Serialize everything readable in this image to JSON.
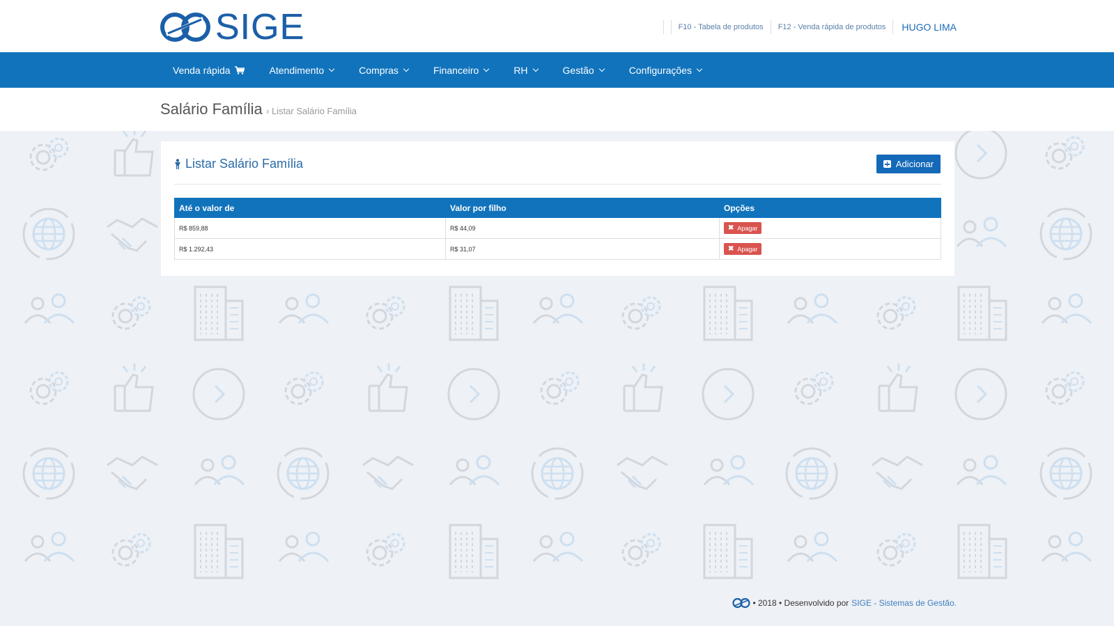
{
  "header": {
    "logo_text": "SIGE",
    "links": [
      "F10 - Tabela de produtos",
      "F12 - Venda rápida de produtos"
    ],
    "user": "HUGO LIMA"
  },
  "nav": {
    "items": [
      {
        "label": "Venda rápida",
        "icon": "cart-icon"
      },
      {
        "label": "Atendimento"
      },
      {
        "label": "Compras"
      },
      {
        "label": "Financeiro"
      },
      {
        "label": "RH"
      },
      {
        "label": "Gestão"
      },
      {
        "label": "Configurações"
      }
    ]
  },
  "page": {
    "title": "Salário Família",
    "breadcrumb": "› Listar Salário Família"
  },
  "panel": {
    "title": "Listar Salário Família",
    "add_label": "Adicionar",
    "columns": [
      "Até o valor de",
      "Valor por filho",
      "Opções"
    ],
    "rows": [
      {
        "ate": "R$ 859,88",
        "valor": "R$ 44,09",
        "action": "Apagar"
      },
      {
        "ate": "R$ 1.292,43",
        "valor": "R$ 31,07",
        "action": "Apagar"
      }
    ]
  },
  "footer": {
    "text": "• 2018 • Desenvolvido por",
    "brand": "SIGE - Sistemas de Gestão."
  },
  "colors": {
    "primary": "#1173bc",
    "danger": "#d9534f",
    "background": "#eef1f5"
  }
}
